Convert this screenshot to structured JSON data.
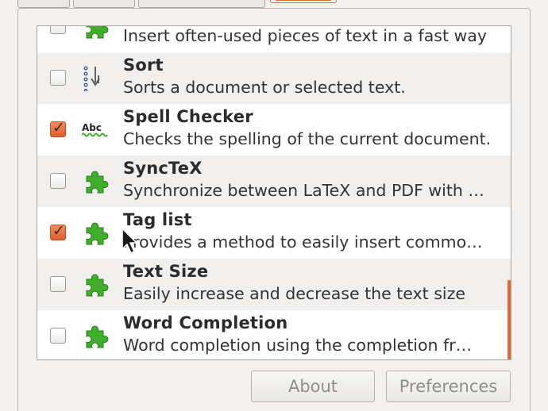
{
  "window": {
    "tabs_visible": 4,
    "active_tab_index": 3
  },
  "plugins": [
    {
      "title": "",
      "description": "Insert often-used pieces of text in a fast way",
      "checked": false,
      "icon": "puzzle-icon"
    },
    {
      "title": "Sort",
      "description": "Sorts a document or selected text.",
      "checked": false,
      "icon": "sort-icon"
    },
    {
      "title": "Spell Checker",
      "description": "Checks the spelling of the current document.",
      "checked": true,
      "icon": "spellcheck-icon"
    },
    {
      "title": "SyncTeX",
      "description": "Synchronize between LaTeX and PDF with …",
      "checked": false,
      "icon": "puzzle-icon"
    },
    {
      "title": "Tag list",
      "description": "Provides a method to easily insert commo…",
      "checked": true,
      "icon": "puzzle-icon"
    },
    {
      "title": "Text Size",
      "description": "Easily increase and decrease the text size",
      "checked": false,
      "icon": "puzzle-icon"
    },
    {
      "title": "Word Completion",
      "description": "Word completion using the completion fr…",
      "checked": false,
      "icon": "puzzle-icon"
    }
  ],
  "buttons": {
    "about_label": "About",
    "preferences_label": "Preferences",
    "about_enabled": false,
    "preferences_enabled": false
  },
  "spellcheck_icon_text": "Abc",
  "colors": {
    "accent": "#e06a33",
    "puzzle_green": "#3fae2a",
    "checked_box": "#e9683a"
  }
}
